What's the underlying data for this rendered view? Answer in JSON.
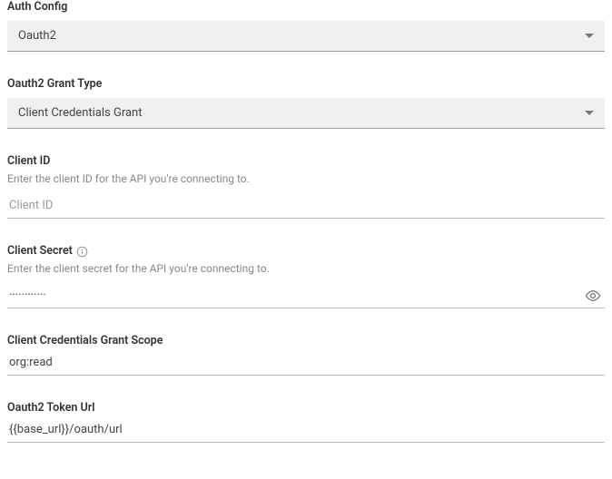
{
  "auth_config": {
    "label": "Auth Config",
    "value": "Oauth2"
  },
  "grant_type": {
    "label": "Oauth2 Grant Type",
    "value": "Client Credentials Grant"
  },
  "client_id": {
    "label": "Client ID",
    "help": "Enter the client ID for the API you're connecting to.",
    "placeholder": "Client ID"
  },
  "client_secret": {
    "label": "Client Secret",
    "help": "Enter the client secret for the API you're connecting to.",
    "masked_value": "············"
  },
  "scope": {
    "label": "Client Credentials Grant Scope",
    "value": "org:read"
  },
  "token_url": {
    "label": "Oauth2 Token Url",
    "value": "{{base_url}}/oauth/url"
  }
}
